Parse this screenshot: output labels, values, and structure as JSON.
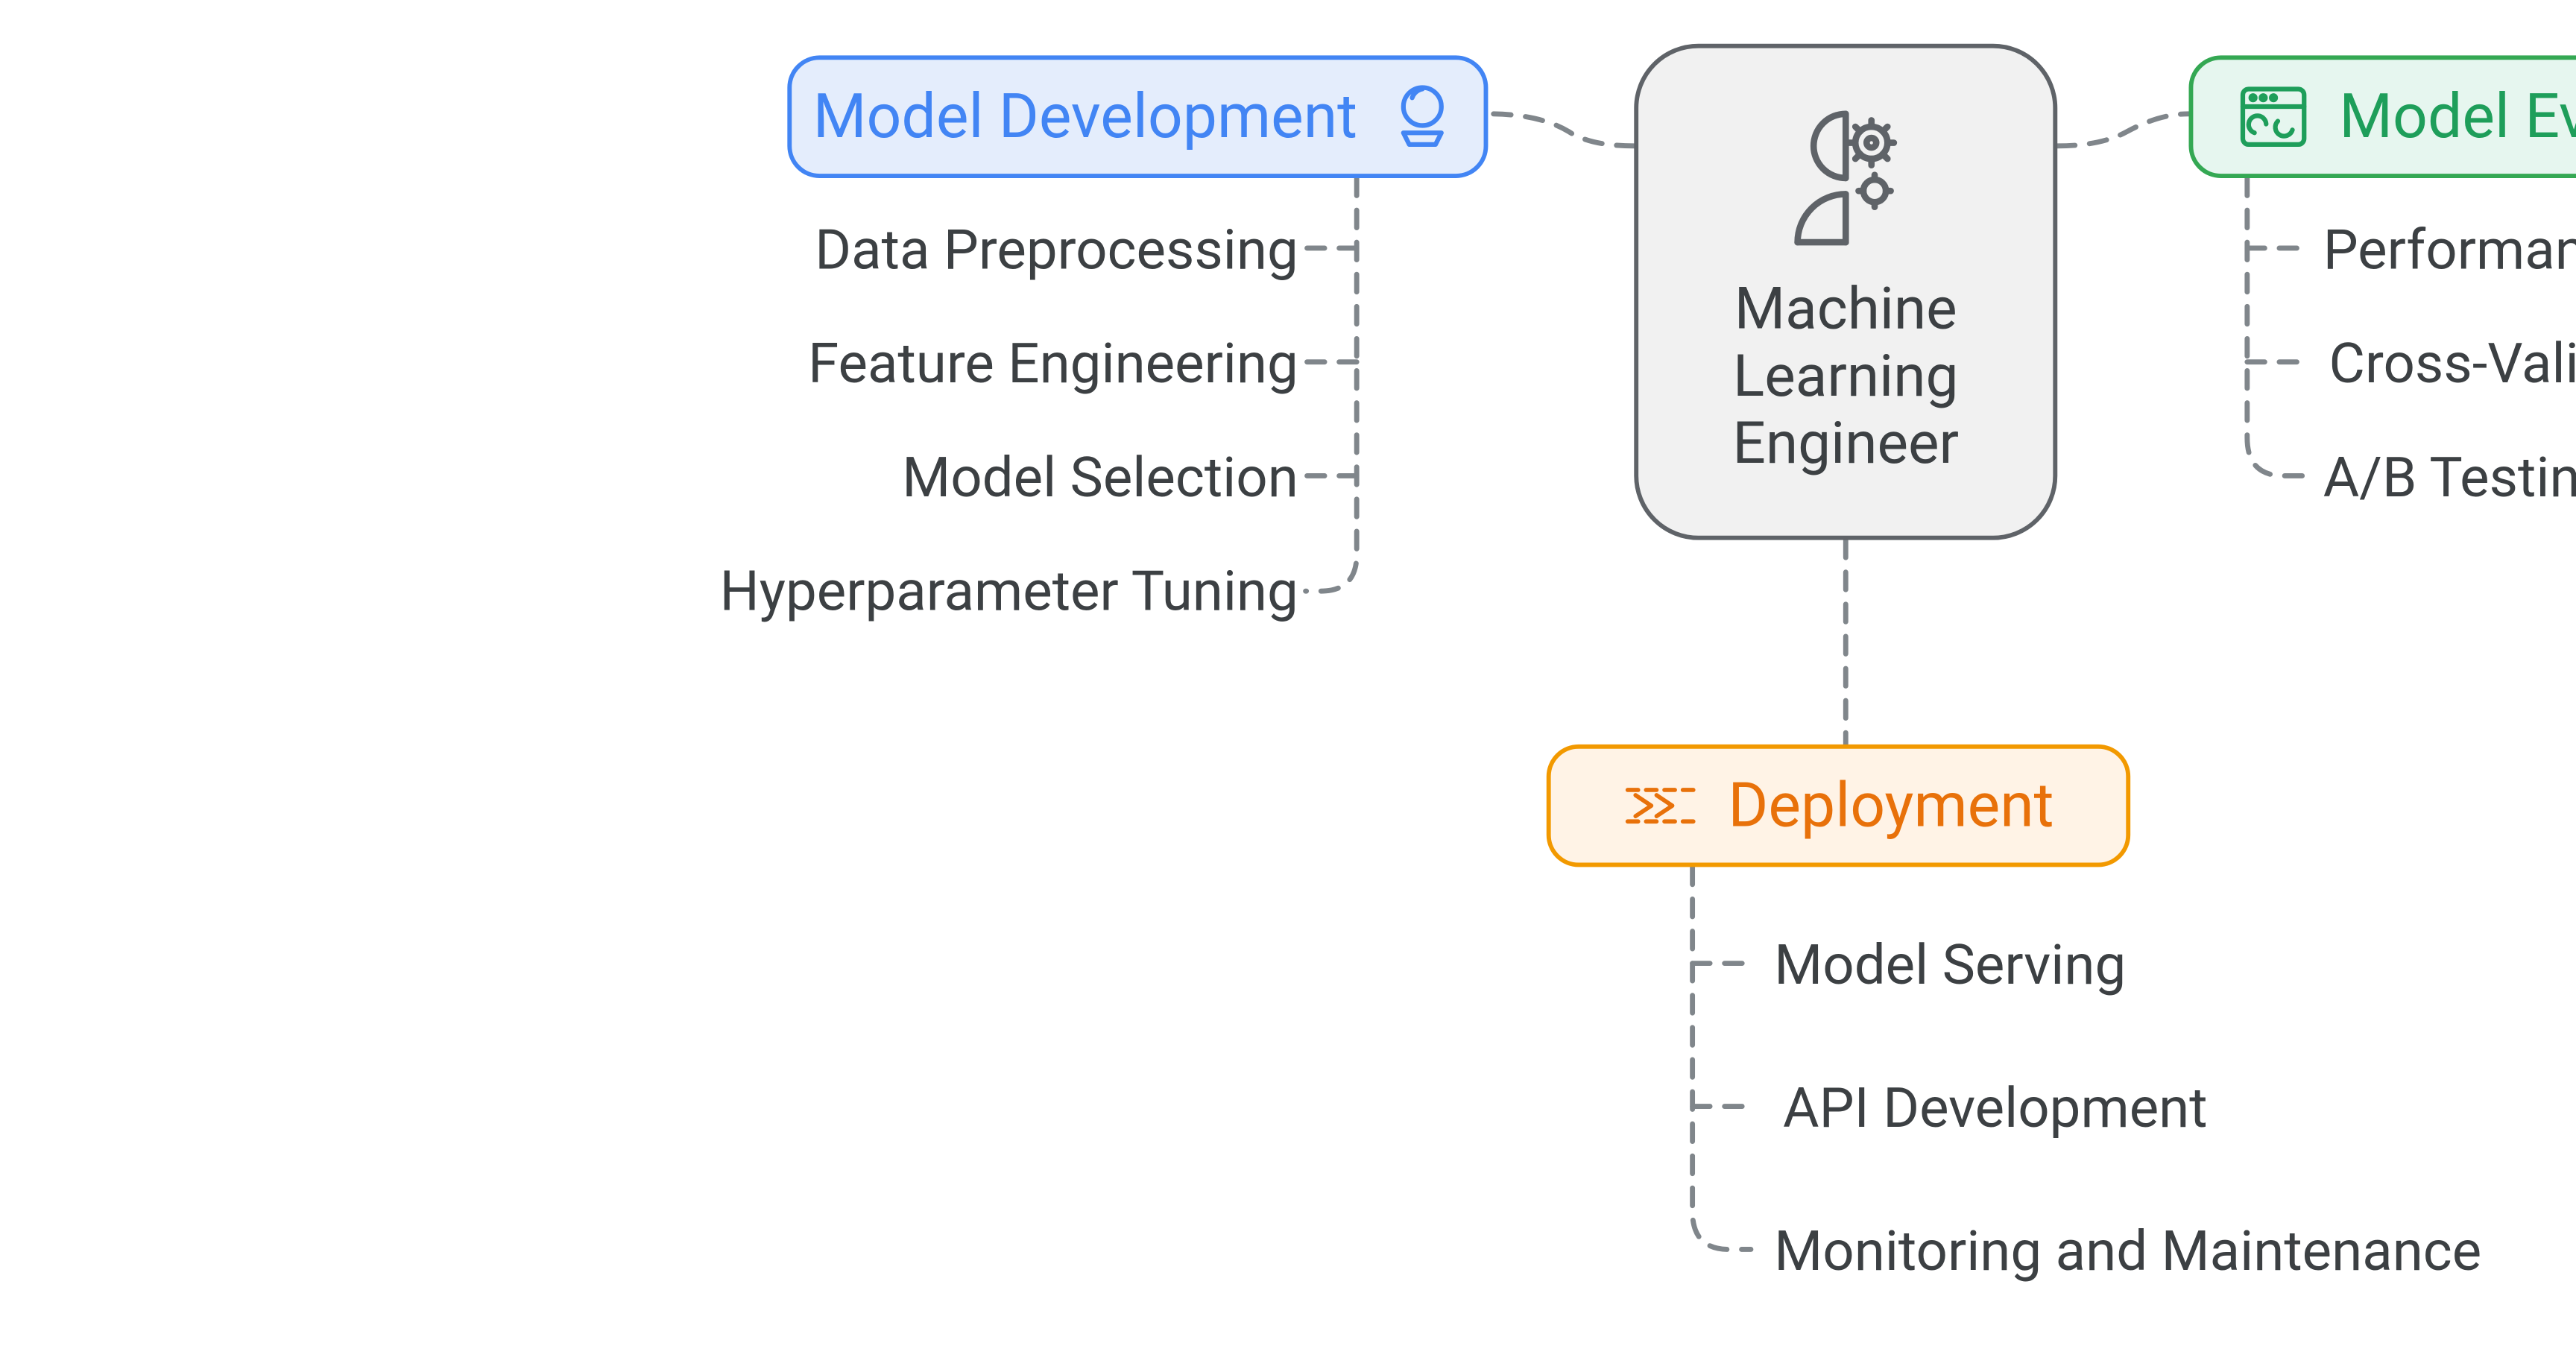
{
  "center": {
    "title_l1": "Machine",
    "title_l2": "Learning",
    "title_l3": "Engineer"
  },
  "branches": {
    "dev": {
      "label": "Model Development",
      "children": [
        "Data Preprocessing",
        "Feature Engineering",
        "Model Selection",
        "Hyperparameter Tuning"
      ]
    },
    "eval": {
      "label": "Model Evaluation",
      "children": [
        "Performance Metrics",
        "Cross-Validation",
        "A/B Testing"
      ]
    },
    "deploy": {
      "label": "Deployment",
      "children": [
        "Model Serving",
        "API Development",
        "Monitoring and Maintenance"
      ]
    }
  },
  "colors": {
    "dev": "#4285f4",
    "eval": "#34a853",
    "deploy": "#f29900",
    "text": "#3c4043",
    "dash": "#80868b"
  }
}
